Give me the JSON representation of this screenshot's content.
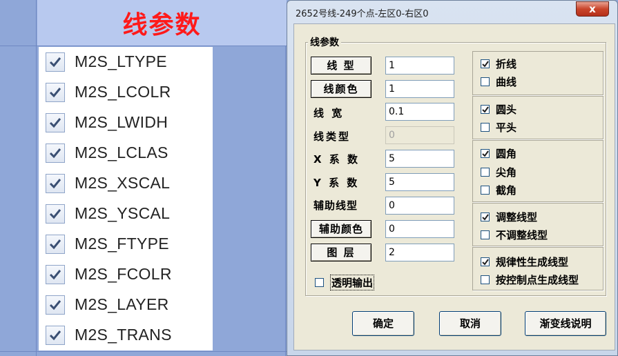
{
  "sheet": {
    "header": "线参数",
    "fields": [
      {
        "label": "M2S_LTYPE",
        "checked": true
      },
      {
        "label": "M2S_LCOLR",
        "checked": true
      },
      {
        "label": "M2S_LWIDH",
        "checked": true
      },
      {
        "label": "M2S_LCLAS",
        "checked": true
      },
      {
        "label": "M2S_XSCAL",
        "checked": true
      },
      {
        "label": "M2S_YSCAL",
        "checked": true
      },
      {
        "label": "M2S_FTYPE",
        "checked": true
      },
      {
        "label": "M2S_FCOLR",
        "checked": true
      },
      {
        "label": "M2S_LAYER",
        "checked": true
      },
      {
        "label": "M2S_TRANS",
        "checked": true
      }
    ]
  },
  "dialog": {
    "title": "2652号线-249个点-左区0-右区0",
    "close_label": "x",
    "group_label": "线参数",
    "params": {
      "line_type": {
        "label": "线 型",
        "value": "1"
      },
      "line_color": {
        "label": "线颜色",
        "value": "1"
      },
      "line_width": {
        "label": "线  宽",
        "value": "0.1"
      },
      "line_class": {
        "label": "线类型",
        "value": "0"
      },
      "x_scale": {
        "label": "X 系 数",
        "value": "5"
      },
      "y_scale": {
        "label": "Y 系 数",
        "value": "5"
      },
      "aux_line_type": {
        "label": "辅助线型",
        "value": "0"
      },
      "aux_color": {
        "label": "辅助颜色",
        "value": "0"
      },
      "layer": {
        "label": "图  层",
        "value": "2"
      }
    },
    "transparent_output": {
      "label": "透明输出",
      "checked": false
    },
    "options": {
      "polyline": {
        "label": "折线",
        "checked": true
      },
      "curve": {
        "label": "曲线",
        "checked": false
      },
      "round_head": {
        "label": "圆头",
        "checked": true
      },
      "flat_head": {
        "label": "平头",
        "checked": false
      },
      "round_corner": {
        "label": "圆角",
        "checked": true
      },
      "sharp_corner": {
        "label": "尖角",
        "checked": false
      },
      "cut_corner": {
        "label": "截角",
        "checked": false
      },
      "adjust_linetype": {
        "label": "调整线型",
        "checked": true
      },
      "no_adjust_linetype": {
        "label": "不调整线型",
        "checked": false
      },
      "regular_generate": {
        "label": "规律性生成线型",
        "checked": true
      },
      "control_point_generate": {
        "label": "按控制点生成线型",
        "checked": false
      }
    },
    "buttons": {
      "ok": "确定",
      "cancel": "取消",
      "gradient_help": "渐变线说明"
    },
    "colors": {
      "header_text": "#ff1a1a",
      "close_button": "#c9452b",
      "check_mark": "#1f1f1f"
    }
  }
}
